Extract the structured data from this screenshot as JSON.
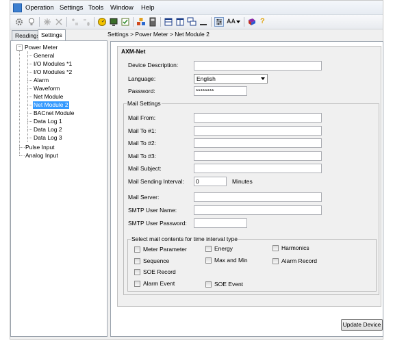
{
  "menu": {
    "items": [
      "Operation",
      "Settings",
      "Tools",
      "Window",
      "Help"
    ]
  },
  "toolbar": {
    "icons": [
      "gear-icon",
      "bulb-icon",
      "asterisk-icon",
      "close-x-icon",
      "expand-icon",
      "collapse-icon",
      "meter-icon",
      "monitor-icon",
      "checkbox-icon",
      "network-icon",
      "calculator-icon",
      "tile-horizontal-icon",
      "tile-vertical-icon",
      "cascade-icon",
      "minimize-icon",
      "settings-panel-icon",
      "font-icon",
      "book-icon",
      "help-icon"
    ],
    "font_label": "AA",
    "help_label": "?"
  },
  "left_tabs": {
    "readings": "Readings",
    "settings": "Settings",
    "active": "Settings"
  },
  "tree": {
    "root": "Power Meter",
    "children": [
      "General",
      "I/O Modules *1",
      "I/O Modules *2",
      "Alarm",
      "Waveform",
      "Net Module",
      "Net Module 2",
      "BACnet Module",
      "Data Log 1",
      "Data Log 2",
      "Data Log 3"
    ],
    "selected": "Net Module 2",
    "siblings": [
      "Pulse Input",
      "Analog Input"
    ],
    "expander_symbol": "−"
  },
  "breadcrumb": "Settings > Power Meter > Net Module 2",
  "axm": {
    "group_title": "AXM-Net",
    "device_description_label": "Device Description:",
    "device_description_value": "",
    "language_label": "Language:",
    "language_value": "English",
    "password_label": "Password:",
    "password_value": "********"
  },
  "mail": {
    "group_title": "Mail Settings",
    "from_label": "Mail From:",
    "to1_label": "Mail To #1:",
    "to2_label": "Mail To #2:",
    "to3_label": "Mail To #3:",
    "subject_label": "Mail Subject:",
    "interval_label": "Mail Sending Interval:",
    "interval_value": "0",
    "interval_unit": "Minutes",
    "server_label": "Mail Server:",
    "smtp_user_label": "SMTP User Name:",
    "smtp_password_label": "SMTP User Password:"
  },
  "contents": {
    "group_title": "Select mail contents  for  time interval type",
    "meter_parameter": "Meter Parameter",
    "energy": "Energy",
    "harmonics": "Harmonics",
    "sequence": "Sequence",
    "max_and_min": "Max and Min",
    "alarm_record": "Alarm Record",
    "soe_record": "SOE Record",
    "alarm_event": "Alarm Event",
    "soe_event": "SOE Event"
  },
  "update_button": "Update Device"
}
